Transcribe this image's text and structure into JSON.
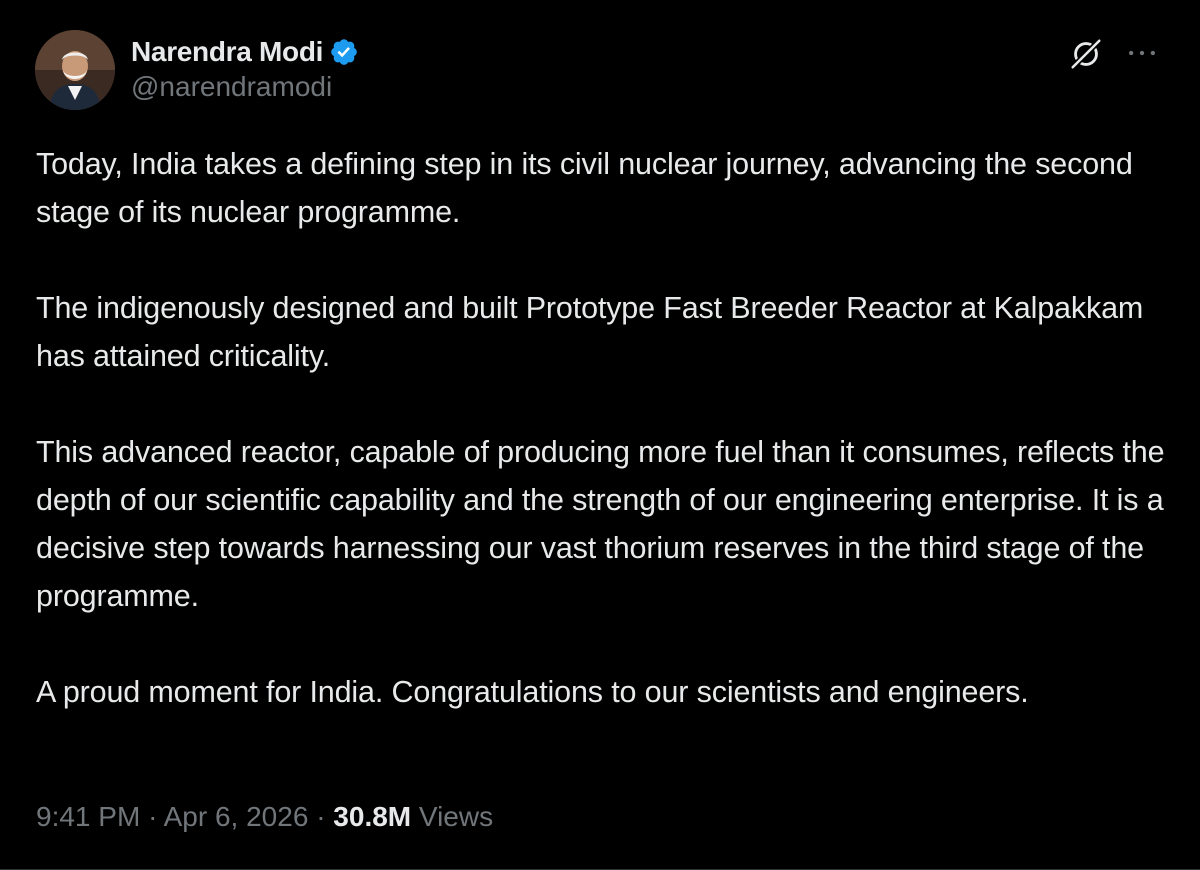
{
  "author": {
    "display_name": "Narendra Modi",
    "handle": "@narendramodi",
    "verified": true,
    "verified_badge_color": "#1d9bf0",
    "avatar_icon": "profile-photo"
  },
  "header_actions": {
    "grok_icon": "grok-icon",
    "more_icon": "more-horizontal-icon"
  },
  "post": {
    "paragraphs": [
      "Today, India takes a defining step in its civil nuclear journey, advancing the second stage of its nuclear programme.",
      "The indigenously designed and built Prototype Fast Breeder Reactor at Kalpakkam has attained criticality.",
      "This advanced reactor, capable of producing more fuel than it consumes, reflects the depth of our scientific capability and the strength of our engineering enterprise. It is a decisive step towards harnessing our vast thorium reserves in the third stage of the programme.",
      "A proud moment for India. Congratulations to our scientists and engineers."
    ]
  },
  "meta": {
    "time": "9:41 PM",
    "separator": "·",
    "date": "Apr 6, 2026",
    "views_count": "30.8M",
    "views_label": "Views"
  },
  "colors": {
    "background": "#000000",
    "text_primary": "#e7e9ea",
    "text_secondary": "#71767b"
  }
}
